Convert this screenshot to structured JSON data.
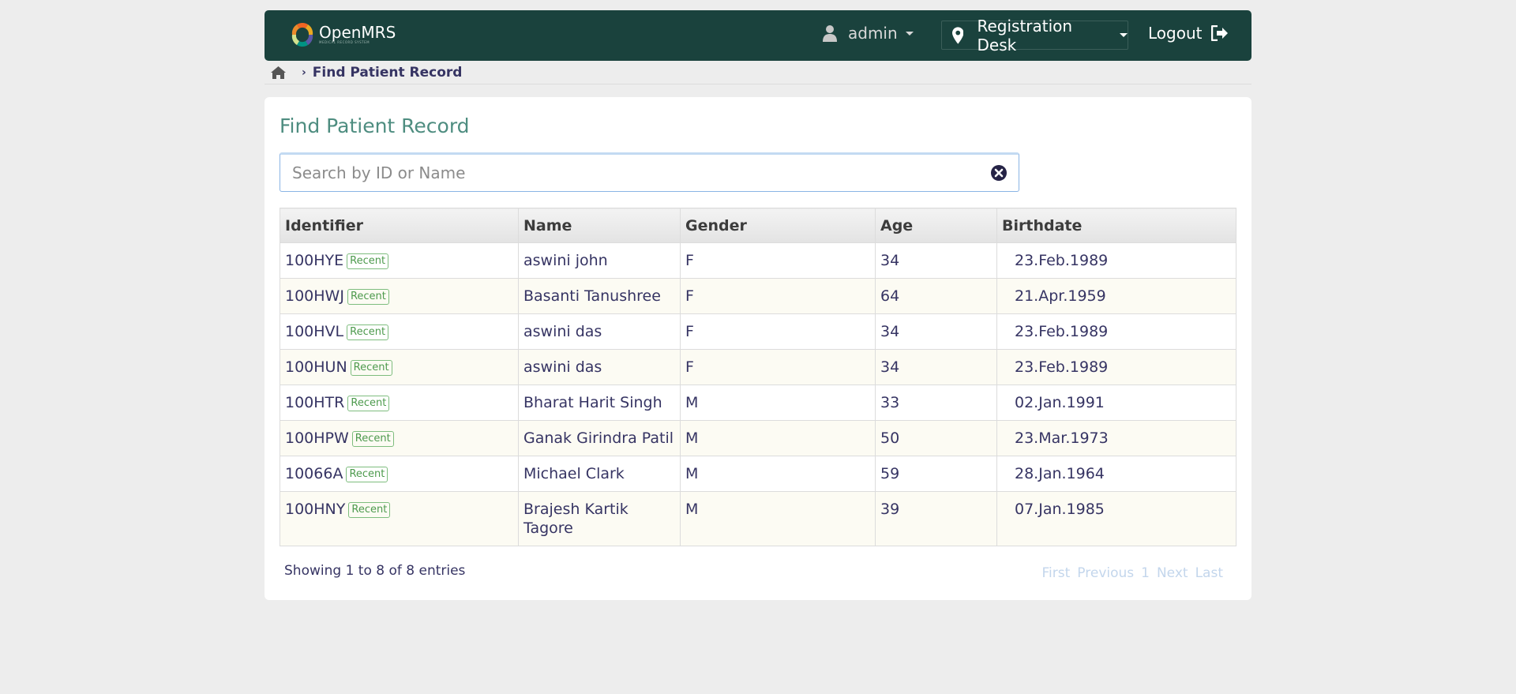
{
  "header": {
    "logo_text": "OpenMRS",
    "logo_subtext": "MEDICAL RECORD SYSTEM",
    "user": "admin",
    "location": "Registration Desk",
    "logout": "Logout"
  },
  "breadcrumb": {
    "current": "Find Patient Record"
  },
  "page": {
    "title": "Find Patient Record",
    "search_placeholder": "Search by ID or Name"
  },
  "table": {
    "columns": [
      "Identifier",
      "Name",
      "Gender",
      "Age",
      "Birthdate"
    ],
    "badge": "Recent",
    "rows": [
      {
        "id": "100HYE",
        "name": "aswini john",
        "gender": "F",
        "age": "34",
        "birthdate": "23.Feb.1989"
      },
      {
        "id": "100HWJ",
        "name": "Basanti Tanushree",
        "gender": "F",
        "age": "64",
        "birthdate": "21.Apr.1959"
      },
      {
        "id": "100HVL",
        "name": "aswini das",
        "gender": "F",
        "age": "34",
        "birthdate": "23.Feb.1989"
      },
      {
        "id": "100HUN",
        "name": "aswini das",
        "gender": "F",
        "age": "34",
        "birthdate": "23.Feb.1989"
      },
      {
        "id": "100HTR",
        "name": "Bharat Harit Singh",
        "gender": "M",
        "age": "33",
        "birthdate": "02.Jan.1991"
      },
      {
        "id": "100HPW",
        "name": "Ganak Girindra Patil",
        "gender": "M",
        "age": "50",
        "birthdate": "23.Mar.1973"
      },
      {
        "id": "10066A",
        "name": "Michael Clark",
        "gender": "M",
        "age": "59",
        "birthdate": "28.Jan.1964"
      },
      {
        "id": "100HNY",
        "name": "Brajesh Kartik Tagore",
        "gender": "M",
        "age": "39",
        "birthdate": "07.Jan.1985"
      }
    ]
  },
  "footer": {
    "info": "Showing 1 to 8 of 8 entries",
    "pager": {
      "first": "First",
      "previous": "Previous",
      "page": "1",
      "next": "Next",
      "last": "Last"
    }
  },
  "colors": {
    "header_bg": "#1a423d",
    "title": "#4e8d80",
    "badge": "#4d9a4d",
    "page_bg": "#ededed"
  }
}
